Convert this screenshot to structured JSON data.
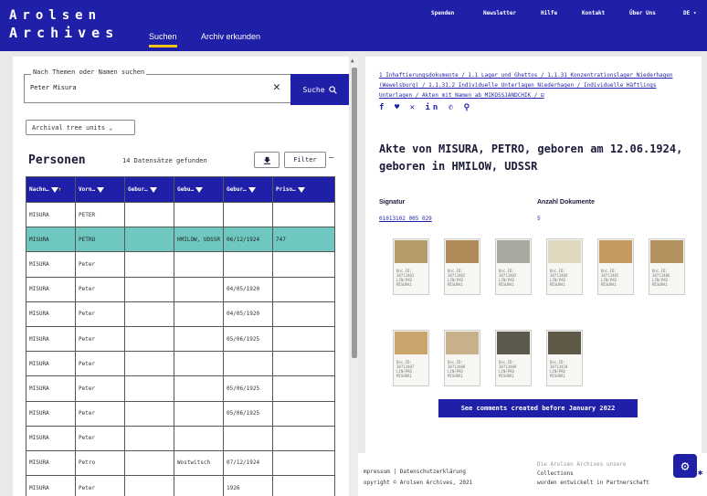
{
  "header": {
    "logo_line1": "Arolsen",
    "logo_line2": "Archives",
    "tabs": [
      "Suchen",
      "Archiv erkunden"
    ],
    "top_nav": [
      "Spenden",
      "Newsletter",
      "Hilfe",
      "Kontakt",
      "Über Uns",
      "DE ▾"
    ]
  },
  "search": {
    "legend": "Nach Themen oder Namen suchen",
    "value": "Peter Misura",
    "clear": "✕",
    "button_label": "Suche",
    "search_icon": "search-icon"
  },
  "tree_select": "Archival tree units ⌄",
  "persons": {
    "title": "Personen",
    "count_text": "14 Datensätze gefunden",
    "filter_label": "Filter",
    "filter_dash": "—"
  },
  "table": {
    "columns": [
      "Nachn…",
      "Vorn…",
      "Gebur…",
      "Gebu…",
      "Gebur…",
      "Priso…"
    ],
    "rows": [
      [
        "MISURA",
        "PETER",
        "",
        "",
        "",
        ""
      ],
      [
        "MISURA",
        "PETRO",
        "",
        "HMILOW, UDSSR",
        "06/12/1924",
        "747"
      ],
      [
        "MISURA",
        "Peter",
        "",
        "",
        "",
        ""
      ],
      [
        "MISURA",
        "Peter",
        "",
        "",
        "04/05/1920",
        ""
      ],
      [
        "MISURA",
        "Peter",
        "",
        "",
        "04/05/1920",
        ""
      ],
      [
        "MISURA",
        "Peter",
        "",
        "",
        "05/06/1925",
        ""
      ],
      [
        "MISURA",
        "Peter",
        "",
        "",
        "",
        ""
      ],
      [
        "MISURA",
        "Peter",
        "",
        "",
        "05/06/1925",
        ""
      ],
      [
        "MISURA",
        "Peter",
        "",
        "",
        "05/06/1925",
        ""
      ],
      [
        "MISURA",
        "Peter",
        "",
        "",
        "",
        ""
      ],
      [
        "MISURA",
        "Petro",
        "",
        "Wostwitsch",
        "07/12/1924",
        ""
      ],
      [
        "MISURA",
        "Peter",
        "",
        "",
        "1926",
        ""
      ]
    ],
    "selected_row": 1
  },
  "detail": {
    "breadcrumb": "1 Inhaftierungsdokumente / 1.1 Lager und Ghettos / 1.1.31 Konzentrationslager Niederhagen (Wewelsburg) / 1.1.31.2 Individuelle Unterlagen Niederhagen / Individuelle Häftlings Unterlagen / Akten mit Namen ab MIKOSSJANDCHIK / ⊟",
    "share_icons": "f ♥ ✕ in ✆ ⚲",
    "title": "Akte von MISURA, PETRO, geboren am 12.06.1924, geboren in HMILOW, UDSSR",
    "signature_label": "Signatur",
    "signature_value": "01013102 005 029",
    "documents_label": "Anzahl Dokumente",
    "documents_value": "5",
    "thumbnails": [
      {
        "label": "Doc.ID:\n38713401\nLIN/PAD\nMISURA1",
        "color": "#b59a6a"
      },
      {
        "label": "Doc.ID:\n38713402\nLIN/PAD\nMISURA1",
        "color": "#b08a58"
      },
      {
        "label": "Doc.ID:\n38713403\nLIN/PAD\nMISURA1",
        "color": "#a9a9a0"
      },
      {
        "label": "Doc.ID:\n38713404\nLIN/PAD\nMISURA1",
        "color": "#e0d9bf"
      },
      {
        "label": "Doc.ID:\n38713405\nLIN/PAD\nMISURA1",
        "color": "#c49a5e"
      },
      {
        "label": "Doc.ID:\n38713406\nLIN/PAD\nMISURA1",
        "color": "#b39260"
      },
      {
        "label": "Doc.ID:\n38713407\nLIN/PAD\nMISURA1",
        "color": "#c9a56c"
      },
      {
        "label": "Doc.ID:\n38713408\nLIN/PAD\nMISURA1",
        "color": "#c8b08a"
      },
      {
        "label": "Doc.ID:\n38713409\nLIN/PAD\nMISURA1",
        "color": "#5b584c"
      },
      {
        "label": "Doc.ID:\n38713410\nLIN/PAD\nMISURA1",
        "color": "#5e5847"
      }
    ],
    "comments_button": "See comments created before January 2022"
  },
  "footer": {
    "imprint": "mpressum  |  Datenschutzerklärung",
    "copyright": "opyright © Arolsen Archives, 2021",
    "right1": "Die Arolsen Archives unsere",
    "right2": "Collections",
    "right3": "wurden entwickelt in Partnerschaft"
  },
  "help": {
    "icon": "⚙",
    "badge": "✱"
  },
  "colors": {
    "brand": "#1f1fa8",
    "accent": "#f2c318",
    "selected_row": "#6ec8c0"
  }
}
